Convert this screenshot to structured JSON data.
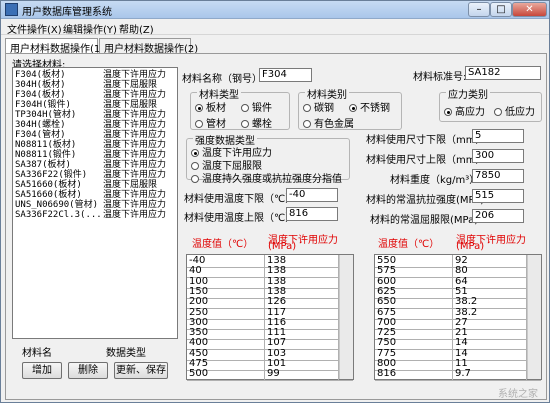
{
  "window": {
    "title": "用户数据库管理系统"
  },
  "menu": [
    "文件操作(X)",
    "编辑操作(Y)",
    "帮助(Z)"
  ],
  "tabs": [
    "用户材料数据操作(1)",
    "用户材料数据操作(2)"
  ],
  "left": {
    "heading": "请选择材料:",
    "items": [
      {
        "name": "F304(板材)",
        "type": "温度下许用应力"
      },
      {
        "name": "304H(板材)",
        "type": "温度下屈服限"
      },
      {
        "name": "F304(板材)",
        "type": "温度下许用应力"
      },
      {
        "name": "F304H(锻件)",
        "type": "温度下屈服限"
      },
      {
        "name": "TP304H(管材)",
        "type": "温度下许用应力"
      },
      {
        "name": "304H(螺栓)",
        "type": "温度下许用应力"
      },
      {
        "name": "F304(管材)",
        "type": "温度下许用应力"
      },
      {
        "name": "N08811(板材)",
        "type": "温度下许用应力"
      },
      {
        "name": "N08811(锻件)",
        "type": "温度下许用应力"
      },
      {
        "name": "SA387(板材)",
        "type": "温度下许用应力"
      },
      {
        "name": "SA336F22(锻件)",
        "type": "温度下许用应力"
      },
      {
        "name": "SA51660(板材)",
        "type": "温度下屈服限"
      },
      {
        "name": "SA51660(板材)",
        "type": "温度下许用应力"
      },
      {
        "name": "UNS_N06690(管材)",
        "type": "温度下许用应力"
      },
      {
        "name": "SA336F22Cl.3(...",
        "type": "温度下许用应力"
      }
    ],
    "footer_col1": "材料名",
    "footer_col2": "数据类型",
    "buttons": {
      "add": "增加",
      "delete": "删除",
      "update": "更新、保存"
    }
  },
  "form": {
    "material_name_label": "材料名称（钢号）:",
    "material_name": "F304",
    "standard_label": "材料标准号:",
    "standard": "SA182",
    "type_group": "材料类型",
    "type_options": [
      "板材",
      "锻件",
      "管材",
      "螺栓"
    ],
    "type_selected": "板材",
    "category_group": "材料类别",
    "category_options": [
      "碳钢",
      "不锈钢",
      "有色金属"
    ],
    "category_selected": "不锈钢",
    "stress_group": "应力类别",
    "stress_options": [
      "高应力",
      "低应力"
    ],
    "stress_selected": "高应力",
    "strength_group": "强度数据类型",
    "strength_options": [
      "温度下许用应力",
      "温度下屈服限",
      "温度持久强度或抗拉强度分指值"
    ],
    "strength_selected": "温度下许用应力",
    "size_min_label": "材料使用尺寸下限（mm）:",
    "size_min": "5",
    "size_max_label": "材料使用尺寸上限（mm）:",
    "size_max": "300",
    "density_label": "材料重度（kg/m³）:",
    "density": "7850",
    "temp_min_label": "材料使用温度下限（℃）:",
    "temp_min": "-40",
    "temp_max_label": "材料使用温度上限（℃）:",
    "temp_max": "816",
    "tensile_label": "材料的常温抗拉强度(MPa):",
    "tensile": "515",
    "yield_label": "材料的常温屈服限(MPa):",
    "yield": "206"
  },
  "table_headers": {
    "temp": "温度值（℃）",
    "stress": "温度下许用应力",
    "unit": "(MPa)"
  },
  "table_left": [
    [
      "-40",
      "138"
    ],
    [
      "40",
      "138"
    ],
    [
      "100",
      "138"
    ],
    [
      "150",
      "138"
    ],
    [
      "200",
      "126"
    ],
    [
      "250",
      "117"
    ],
    [
      "300",
      "116"
    ],
    [
      "350",
      "111"
    ],
    [
      "400",
      "107"
    ],
    [
      "450",
      "103"
    ],
    [
      "475",
      "101"
    ],
    [
      "500",
      "99"
    ]
  ],
  "table_right": [
    [
      "550",
      "92"
    ],
    [
      "575",
      "80"
    ],
    [
      "600",
      "64"
    ],
    [
      "625",
      "51"
    ],
    [
      "650",
      "38.2"
    ],
    [
      "675",
      "38.2"
    ],
    [
      "700",
      "27"
    ],
    [
      "725",
      "21"
    ],
    [
      "750",
      "14"
    ],
    [
      "775",
      "14"
    ],
    [
      "800",
      "11"
    ],
    [
      "816",
      "9.7"
    ]
  ],
  "watermark": "系统之家"
}
